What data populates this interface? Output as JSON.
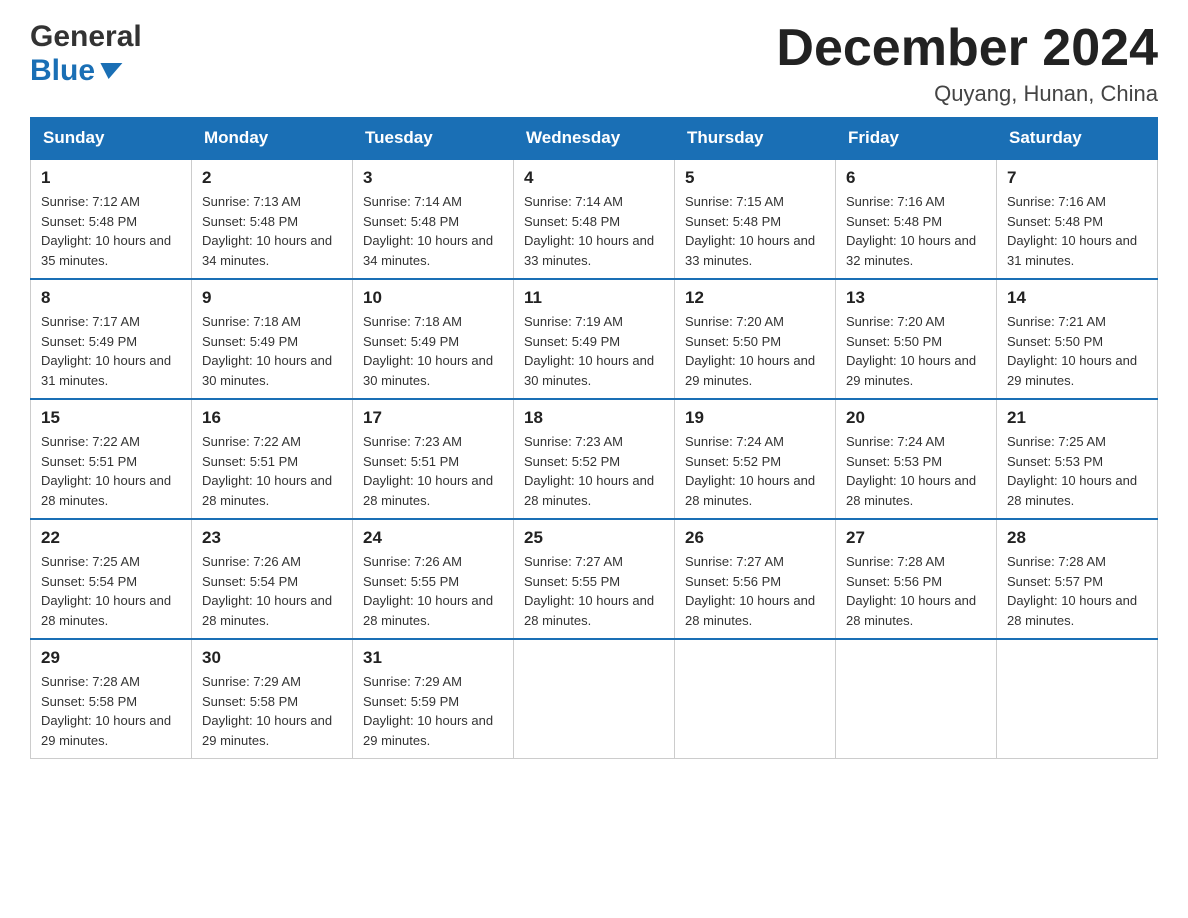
{
  "logo": {
    "general": "General",
    "blue": "Blue"
  },
  "title": "December 2024",
  "location": "Quyang, Hunan, China",
  "days_of_week": [
    "Sunday",
    "Monday",
    "Tuesday",
    "Wednesday",
    "Thursday",
    "Friday",
    "Saturday"
  ],
  "weeks": [
    [
      {
        "day": "1",
        "sunrise": "7:12 AM",
        "sunset": "5:48 PM",
        "daylight": "10 hours and 35 minutes."
      },
      {
        "day": "2",
        "sunrise": "7:13 AM",
        "sunset": "5:48 PM",
        "daylight": "10 hours and 34 minutes."
      },
      {
        "day": "3",
        "sunrise": "7:14 AM",
        "sunset": "5:48 PM",
        "daylight": "10 hours and 34 minutes."
      },
      {
        "day": "4",
        "sunrise": "7:14 AM",
        "sunset": "5:48 PM",
        "daylight": "10 hours and 33 minutes."
      },
      {
        "day": "5",
        "sunrise": "7:15 AM",
        "sunset": "5:48 PM",
        "daylight": "10 hours and 33 minutes."
      },
      {
        "day": "6",
        "sunrise": "7:16 AM",
        "sunset": "5:48 PM",
        "daylight": "10 hours and 32 minutes."
      },
      {
        "day": "7",
        "sunrise": "7:16 AM",
        "sunset": "5:48 PM",
        "daylight": "10 hours and 31 minutes."
      }
    ],
    [
      {
        "day": "8",
        "sunrise": "7:17 AM",
        "sunset": "5:49 PM",
        "daylight": "10 hours and 31 minutes."
      },
      {
        "day": "9",
        "sunrise": "7:18 AM",
        "sunset": "5:49 PM",
        "daylight": "10 hours and 30 minutes."
      },
      {
        "day": "10",
        "sunrise": "7:18 AM",
        "sunset": "5:49 PM",
        "daylight": "10 hours and 30 minutes."
      },
      {
        "day": "11",
        "sunrise": "7:19 AM",
        "sunset": "5:49 PM",
        "daylight": "10 hours and 30 minutes."
      },
      {
        "day": "12",
        "sunrise": "7:20 AM",
        "sunset": "5:50 PM",
        "daylight": "10 hours and 29 minutes."
      },
      {
        "day": "13",
        "sunrise": "7:20 AM",
        "sunset": "5:50 PM",
        "daylight": "10 hours and 29 minutes."
      },
      {
        "day": "14",
        "sunrise": "7:21 AM",
        "sunset": "5:50 PM",
        "daylight": "10 hours and 29 minutes."
      }
    ],
    [
      {
        "day": "15",
        "sunrise": "7:22 AM",
        "sunset": "5:51 PM",
        "daylight": "10 hours and 28 minutes."
      },
      {
        "day": "16",
        "sunrise": "7:22 AM",
        "sunset": "5:51 PM",
        "daylight": "10 hours and 28 minutes."
      },
      {
        "day": "17",
        "sunrise": "7:23 AM",
        "sunset": "5:51 PM",
        "daylight": "10 hours and 28 minutes."
      },
      {
        "day": "18",
        "sunrise": "7:23 AM",
        "sunset": "5:52 PM",
        "daylight": "10 hours and 28 minutes."
      },
      {
        "day": "19",
        "sunrise": "7:24 AM",
        "sunset": "5:52 PM",
        "daylight": "10 hours and 28 minutes."
      },
      {
        "day": "20",
        "sunrise": "7:24 AM",
        "sunset": "5:53 PM",
        "daylight": "10 hours and 28 minutes."
      },
      {
        "day": "21",
        "sunrise": "7:25 AM",
        "sunset": "5:53 PM",
        "daylight": "10 hours and 28 minutes."
      }
    ],
    [
      {
        "day": "22",
        "sunrise": "7:25 AM",
        "sunset": "5:54 PM",
        "daylight": "10 hours and 28 minutes."
      },
      {
        "day": "23",
        "sunrise": "7:26 AM",
        "sunset": "5:54 PM",
        "daylight": "10 hours and 28 minutes."
      },
      {
        "day": "24",
        "sunrise": "7:26 AM",
        "sunset": "5:55 PM",
        "daylight": "10 hours and 28 minutes."
      },
      {
        "day": "25",
        "sunrise": "7:27 AM",
        "sunset": "5:55 PM",
        "daylight": "10 hours and 28 minutes."
      },
      {
        "day": "26",
        "sunrise": "7:27 AM",
        "sunset": "5:56 PM",
        "daylight": "10 hours and 28 minutes."
      },
      {
        "day": "27",
        "sunrise": "7:28 AM",
        "sunset": "5:56 PM",
        "daylight": "10 hours and 28 minutes."
      },
      {
        "day": "28",
        "sunrise": "7:28 AM",
        "sunset": "5:57 PM",
        "daylight": "10 hours and 28 minutes."
      }
    ],
    [
      {
        "day": "29",
        "sunrise": "7:28 AM",
        "sunset": "5:58 PM",
        "daylight": "10 hours and 29 minutes."
      },
      {
        "day": "30",
        "sunrise": "7:29 AM",
        "sunset": "5:58 PM",
        "daylight": "10 hours and 29 minutes."
      },
      {
        "day": "31",
        "sunrise": "7:29 AM",
        "sunset": "5:59 PM",
        "daylight": "10 hours and 29 minutes."
      },
      null,
      null,
      null,
      null
    ]
  ]
}
